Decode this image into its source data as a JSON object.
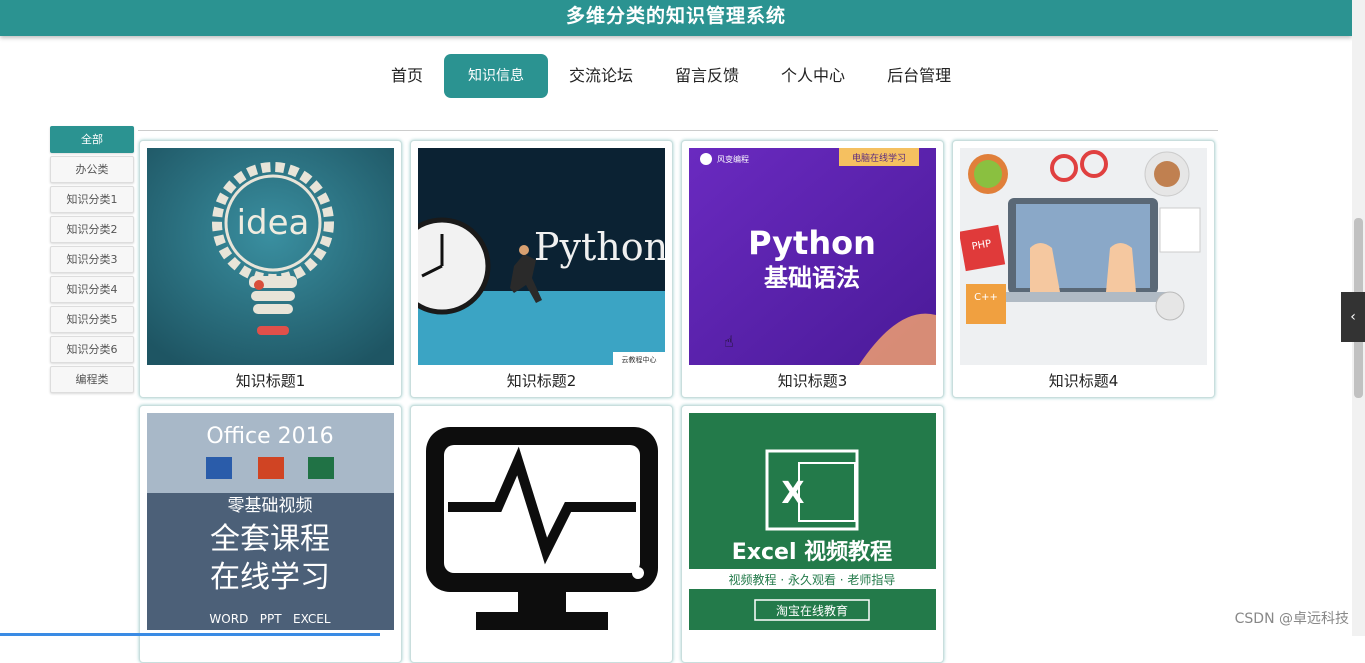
{
  "header": {
    "title": "多维分类的知识管理系统"
  },
  "nav": {
    "items": [
      {
        "label": "首页"
      },
      {
        "label": "知识信息"
      },
      {
        "label": "交流论坛"
      },
      {
        "label": "留言反馈"
      },
      {
        "label": "个人中心"
      },
      {
        "label": "后台管理"
      }
    ],
    "active": "知识信息"
  },
  "sidebar": {
    "categories": [
      {
        "label": "全部"
      },
      {
        "label": "办公类"
      },
      {
        "label": "知识分类1"
      },
      {
        "label": "知识分类2"
      },
      {
        "label": "知识分类3"
      },
      {
        "label": "知识分类4"
      },
      {
        "label": "知识分类5"
      },
      {
        "label": "知识分类6"
      },
      {
        "label": "编程类"
      }
    ],
    "active": "全部"
  },
  "cards": [
    {
      "title": "知识标题1",
      "thumb_text": "idea"
    },
    {
      "title": "知识标题2",
      "thumb_text": "Python",
      "thumb_badge": "云教程中心"
    },
    {
      "title": "知识标题3",
      "thumb_text": "Python",
      "thumb_sub": "基础语法",
      "thumb_brand": "风变编程",
      "thumb_tag": "电脑在线学习"
    },
    {
      "title": "知识标题4",
      "thumb_labels": [
        "PHP",
        "C++"
      ]
    },
    {
      "title": "",
      "thumb_text": "Office 2016",
      "thumb_sub": "零基础视频",
      "thumb_line1": "全套课程",
      "thumb_line2": "在线学习",
      "thumb_words": "WORD   PPT   EXCEL"
    },
    {
      "title": ""
    },
    {
      "title": "",
      "thumb_text": "Excel 视频教程",
      "thumb_sub": "视频教程 · 永久观看 · 老师指导",
      "thumb_badge": "淘宝在线教育"
    }
  ],
  "side_tab": {
    "icon": "chevron-left-icon",
    "glyph": "‹"
  },
  "watermark": "CSDN @卓远科技",
  "colors": {
    "primary": "#2b9391",
    "header_text": "#ffffff"
  }
}
